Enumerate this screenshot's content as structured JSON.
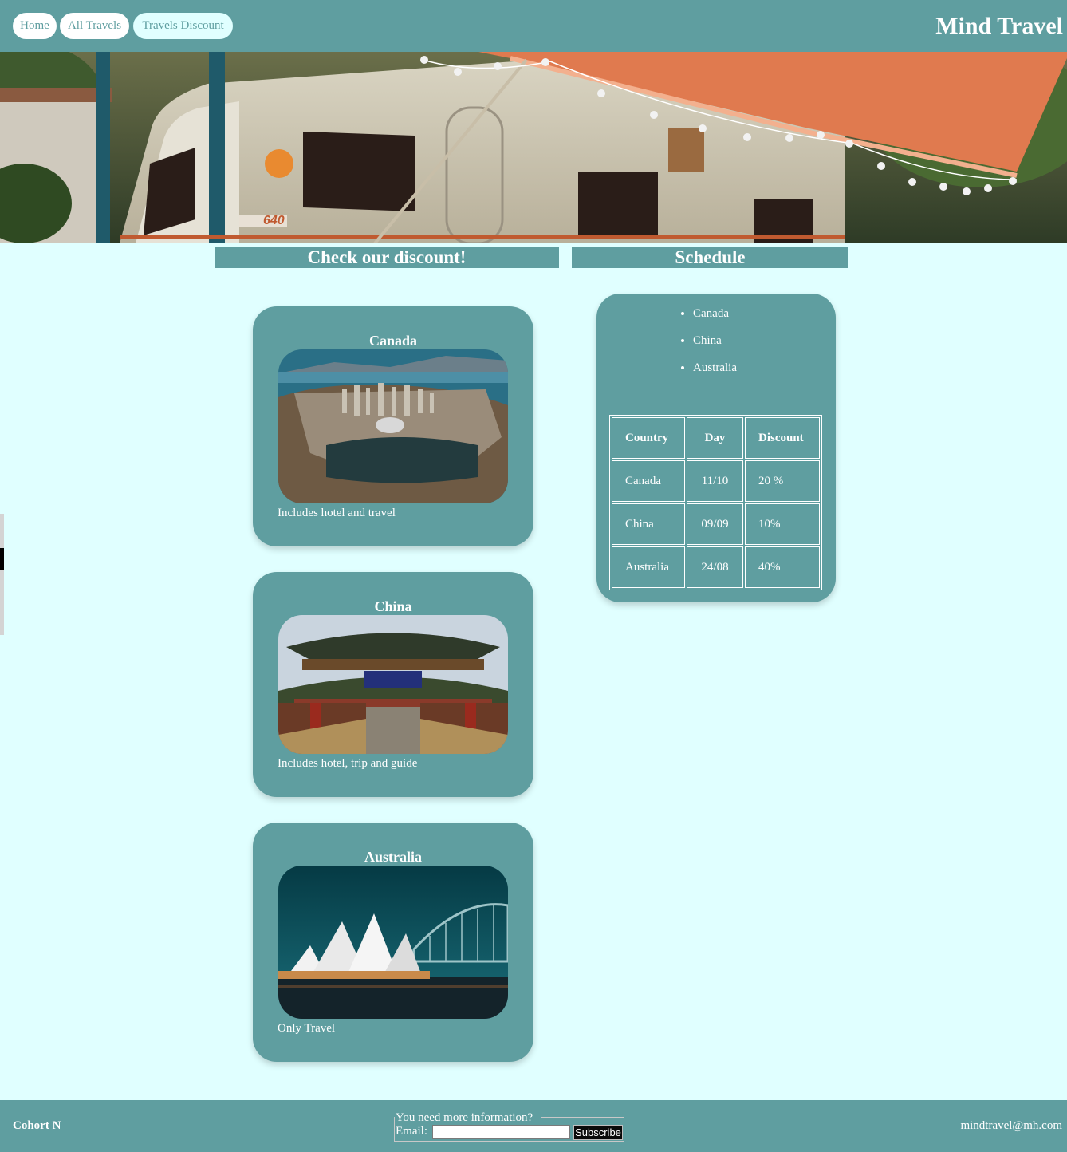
{
  "header": {
    "nav": [
      {
        "label": "Home"
      },
      {
        "label": "All Travels"
      },
      {
        "label": "Travels Discount"
      }
    ],
    "brand": "Mind Travel"
  },
  "hero": {
    "caravan_badge": "640"
  },
  "sections": {
    "discount_title": "Check our discount!",
    "schedule_title": "Schedule"
  },
  "cards": [
    {
      "title": "Canada",
      "description": "Includes hotel and travel"
    },
    {
      "title": "China",
      "description": "Includes hotel, trip and guide"
    },
    {
      "title": "Australia",
      "description": "Only Travel"
    }
  ],
  "schedule": {
    "list": [
      "Canada",
      "China",
      "Australia"
    ],
    "table": {
      "headers": [
        "Country",
        "Day",
        "Discount"
      ],
      "rows": [
        [
          "Canada",
          "11/10",
          "20 %"
        ],
        [
          "China",
          "09/09",
          "10%"
        ],
        [
          "Australia",
          "24/08",
          "40%"
        ]
      ]
    }
  },
  "footer": {
    "cohort": "Cohort N",
    "legend": "You need more information?",
    "email_label": "Email:",
    "email_value": "",
    "subscribe_label": "Subscribe",
    "contact_email": "mindtravel@mh.com"
  },
  "colors": {
    "primary": "#5f9ea0",
    "background": "#e0ffff",
    "text": "#ffffff"
  }
}
